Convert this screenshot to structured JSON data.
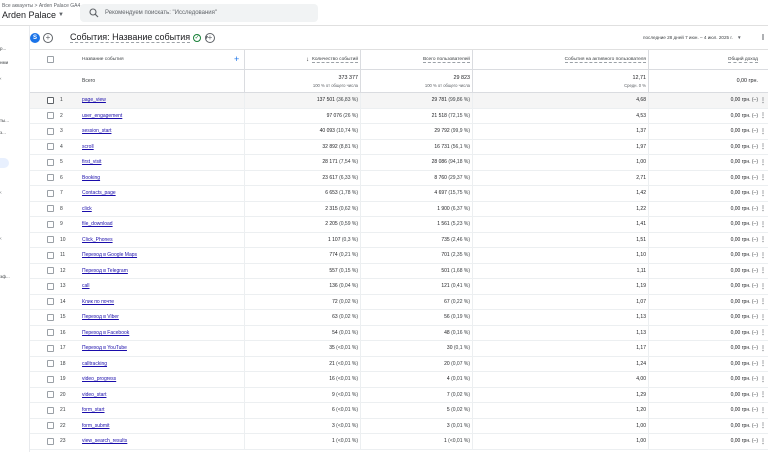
{
  "header": {
    "breadcrumb": "Все аккаунты > Arden Palace GA4",
    "property": "Arden Palace",
    "search_placeholder": "Рекомендуем поискать: \"Исследования\""
  },
  "rail": {
    "fragments": [
      "р...",
      "нми",
      "‹",
      "ты...",
      "з...",
      "‹",
      "‹",
      "эф..."
    ]
  },
  "toolbar": {
    "badge": "S",
    "title": "События: Название события",
    "date_range_label": "последние 28 дней",
    "date_range": "7 июн. – 4 июл. 2025 г."
  },
  "table": {
    "headers": {
      "name": "Название события",
      "count": "Количество событий",
      "users": "Всего пользователей",
      "per_user": "События на активного пользователя",
      "revenue": "Общий доход"
    },
    "totals": {
      "label": "Всего",
      "count": "373 377",
      "count_sub": "100 % от общего числа",
      "users": "29 823",
      "users_sub": "100 % от общего числа",
      "per_user": "12,71",
      "per_user_sub": "Средн. 0 %",
      "revenue": "0,00 грн."
    },
    "rows": [
      {
        "idx": "1",
        "name": "page_view",
        "count": "137 501",
        "count_pct": "(36,83 %)",
        "users": "29 781",
        "users_pct": "(99,86 %)",
        "per_user": "4,68",
        "revenue": "0,00 грн.",
        "rev_trend": "(–)"
      },
      {
        "idx": "2",
        "name": "user_engagement",
        "count": "97 076",
        "count_pct": "(26 %)",
        "users": "21 518",
        "users_pct": "(72,15 %)",
        "per_user": "4,53",
        "revenue": "0,00 грн.",
        "rev_trend": "(–)"
      },
      {
        "idx": "3",
        "name": "session_start",
        "count": "40 093",
        "count_pct": "(10,74 %)",
        "users": "29 792",
        "users_pct": "(99,9 %)",
        "per_user": "1,37",
        "revenue": "0,00 грн.",
        "rev_trend": "(–)"
      },
      {
        "idx": "4",
        "name": "scroll",
        "count": "32 892",
        "count_pct": "(8,81 %)",
        "users": "16 731",
        "users_pct": "(56,1 %)",
        "per_user": "1,97",
        "revenue": "0,00 грн.",
        "rev_trend": "(–)"
      },
      {
        "idx": "5",
        "name": "first_visit",
        "count": "28 171",
        "count_pct": "(7,54 %)",
        "users": "28 086",
        "users_pct": "(94,18 %)",
        "per_user": "1,00",
        "revenue": "0,00 грн.",
        "rev_trend": "(–)"
      },
      {
        "idx": "6",
        "name": "Booking",
        "count": "23 617",
        "count_pct": "(6,33 %)",
        "users": "8 760",
        "users_pct": "(29,37 %)",
        "per_user": "2,71",
        "revenue": "0,00 грн.",
        "rev_trend": "(–)"
      },
      {
        "idx": "7",
        "name": "Contacts_page",
        "count": "6 653",
        "count_pct": "(1,78 %)",
        "users": "4 697",
        "users_pct": "(15,75 %)",
        "per_user": "1,42",
        "revenue": "0,00 грн.",
        "rev_trend": "(–)"
      },
      {
        "idx": "8",
        "name": "click",
        "count": "2 315",
        "count_pct": "(0,62 %)",
        "users": "1 900",
        "users_pct": "(6,37 %)",
        "per_user": "1,22",
        "revenue": "0,00 грн.",
        "rev_trend": "(–)"
      },
      {
        "idx": "9",
        "name": "file_download",
        "count": "2 205",
        "count_pct": "(0,59 %)",
        "users": "1 561",
        "users_pct": "(5,23 %)",
        "per_user": "1,41",
        "revenue": "0,00 грн.",
        "rev_trend": "(–)"
      },
      {
        "idx": "10",
        "name": "Click_Phones",
        "count": "1 107",
        "count_pct": "(0,3 %)",
        "users": "735",
        "users_pct": "(2,46 %)",
        "per_user": "1,51",
        "revenue": "0,00 грн.",
        "rev_trend": "(–)"
      },
      {
        "idx": "11",
        "name": "Переход в Google Maps",
        "count": "774",
        "count_pct": "(0,21 %)",
        "users": "701",
        "users_pct": "(2,35 %)",
        "per_user": "1,10",
        "revenue": "0,00 грн.",
        "rev_trend": "(–)"
      },
      {
        "idx": "12",
        "name": "Переход в Telegram",
        "count": "557",
        "count_pct": "(0,15 %)",
        "users": "501",
        "users_pct": "(1,68 %)",
        "per_user": "1,11",
        "revenue": "0,00 грн.",
        "rev_trend": "(–)"
      },
      {
        "idx": "13",
        "name": "call",
        "count": "136",
        "count_pct": "(0,04 %)",
        "users": "121",
        "users_pct": "(0,41 %)",
        "per_user": "1,19",
        "revenue": "0,00 грн.",
        "rev_trend": "(–)"
      },
      {
        "idx": "14",
        "name": "Клик по почте",
        "count": "72",
        "count_pct": "(0,02 %)",
        "users": "67",
        "users_pct": "(0,22 %)",
        "per_user": "1,07",
        "revenue": "0,00 грн.",
        "rev_trend": "(–)"
      },
      {
        "idx": "15",
        "name": "Переход в Viber",
        "count": "63",
        "count_pct": "(0,02 %)",
        "users": "56",
        "users_pct": "(0,19 %)",
        "per_user": "1,13",
        "revenue": "0,00 грн.",
        "rev_trend": "(–)"
      },
      {
        "idx": "16",
        "name": "Переход в Facebook",
        "count": "54",
        "count_pct": "(0,01 %)",
        "users": "48",
        "users_pct": "(0,16 %)",
        "per_user": "1,13",
        "revenue": "0,00 грн.",
        "rev_trend": "(–)"
      },
      {
        "idx": "17",
        "name": "Переход в YouTube",
        "count": "35",
        "count_pct": "(<0,01 %)",
        "users": "30",
        "users_pct": "(0,1 %)",
        "per_user": "1,17",
        "revenue": "0,00 грн.",
        "rev_trend": "(–)"
      },
      {
        "idx": "18",
        "name": "calltracking",
        "count": "21",
        "count_pct": "(<0,01 %)",
        "users": "20",
        "users_pct": "(0,07 %)",
        "per_user": "1,24",
        "revenue": "0,00 грн.",
        "rev_trend": "(–)"
      },
      {
        "idx": "19",
        "name": "video_progress",
        "count": "16",
        "count_pct": "(<0,01 %)",
        "users": "4",
        "users_pct": "(0,01 %)",
        "per_user": "4,00",
        "revenue": "0,00 грн.",
        "rev_trend": "(–)"
      },
      {
        "idx": "20",
        "name": "video_start",
        "count": "9",
        "count_pct": "(<0,01 %)",
        "users": "7",
        "users_pct": "(0,02 %)",
        "per_user": "1,29",
        "revenue": "0,00 грн.",
        "rev_trend": "(–)"
      },
      {
        "idx": "21",
        "name": "form_start",
        "count": "6",
        "count_pct": "(<0,01 %)",
        "users": "5",
        "users_pct": "(0,02 %)",
        "per_user": "1,20",
        "revenue": "0,00 грн.",
        "rev_trend": "(–)"
      },
      {
        "idx": "22",
        "name": "form_submit",
        "count": "3",
        "count_pct": "(<0,01 %)",
        "users": "3",
        "users_pct": "(0,01 %)",
        "per_user": "1,00",
        "revenue": "0,00 грн.",
        "rev_trend": "(–)"
      },
      {
        "idx": "23",
        "name": "view_search_results",
        "count": "1",
        "count_pct": "(<0,01 %)",
        "users": "1",
        "users_pct": "(<0,01 %)",
        "per_user": "1,00",
        "revenue": "0,00 грн.",
        "rev_trend": "(–)"
      }
    ]
  },
  "colors": {
    "accent": "#1a73e8",
    "link": "#1a0dab",
    "success": "#188038",
    "row_highlight": "#f5f5f5"
  },
  "icons": {
    "search": "search-icon",
    "add": "plus-icon",
    "status": "check-circle-icon",
    "more": "more-vert-icon",
    "sort": "arrow-down-icon"
  }
}
